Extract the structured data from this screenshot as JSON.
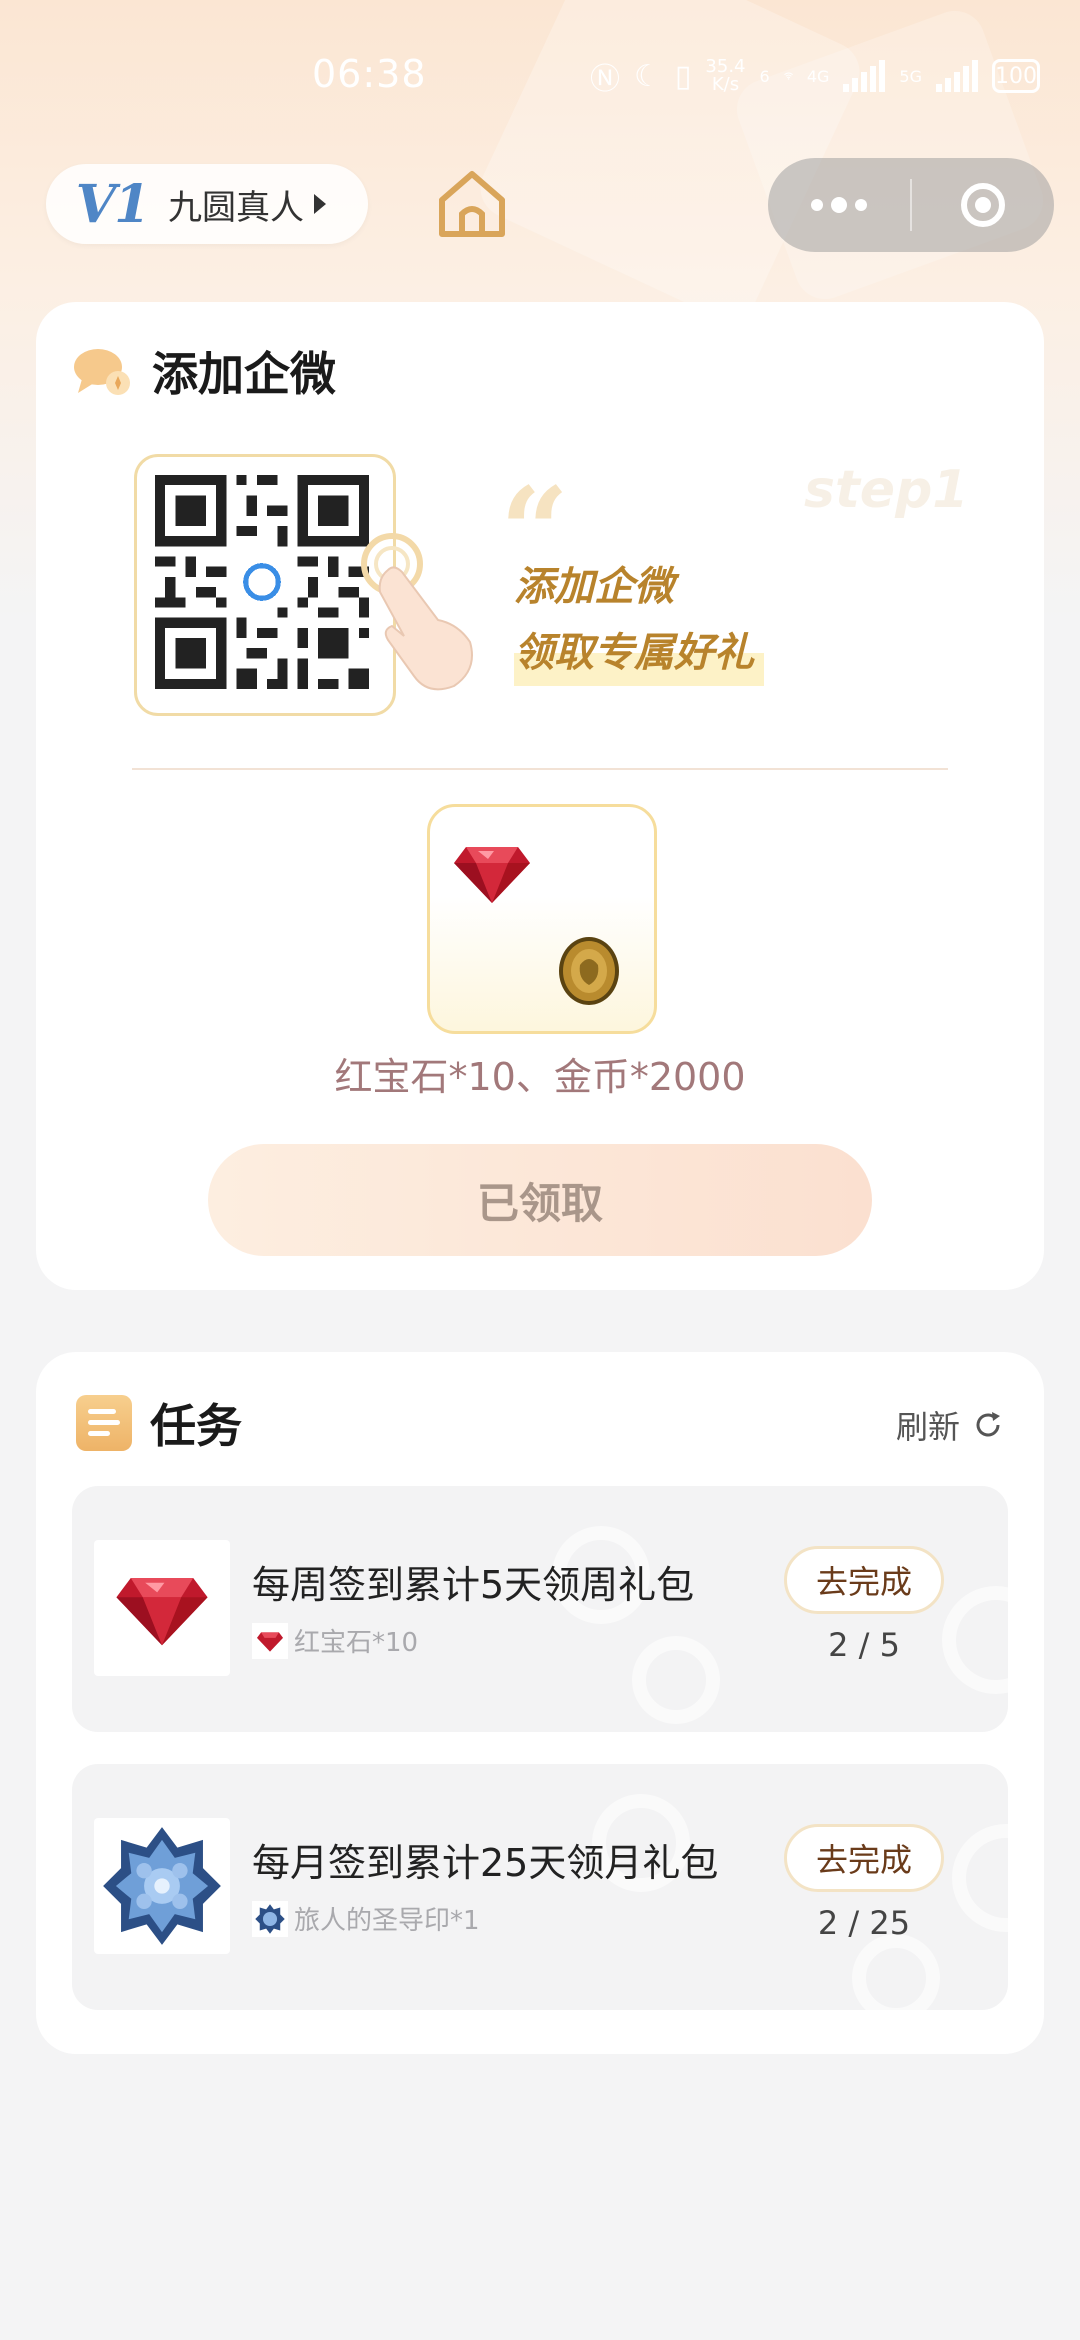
{
  "status_bar": {
    "time": "06:38",
    "net_speed_value": "35.4",
    "net_speed_unit": "K/s",
    "net_6": "6",
    "net_4g": "4G",
    "net_5g": "5G",
    "battery": "100"
  },
  "header": {
    "brand_logo_text": "V1",
    "brand_name": "九圆真人"
  },
  "wecom_card": {
    "title": "添加企微",
    "step_label": "step1",
    "promo_line1": "添加企微",
    "promo_line2": "领取专属好礼",
    "reward_text": "红宝石*10、金币*2000",
    "claim_button": "已领取"
  },
  "tasks_card": {
    "title": "任务",
    "refresh_label": "刷新",
    "items": [
      {
        "name": "每周签到累计5天领周礼包",
        "reward": "红宝石*10",
        "action": "去完成",
        "progress": "2 / 5",
        "progress_current": 2,
        "progress_total": 5
      },
      {
        "name": "每月签到累计25天领月礼包",
        "reward": "旅人的圣导印*1",
        "action": "去完成",
        "progress": "2 / 25",
        "progress_current": 2,
        "progress_total": 25
      }
    ]
  },
  "colors": {
    "accent_gold": "#b8832c",
    "logo_blue": "#4f86c6",
    "muted_reward": "#a2787a",
    "button_text_brown": "#6a3b1a"
  }
}
